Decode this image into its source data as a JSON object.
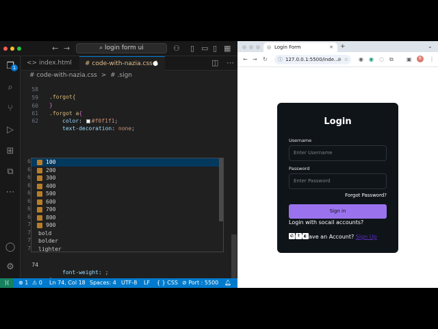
{
  "vscode": {
    "search": "login form ui",
    "tabs": [
      {
        "label": "<> index.html"
      },
      {
        "label": "# code-with-nazia.css 1"
      }
    ],
    "breadcrumb": [
      "# code-with-nazia.css",
      ">",
      "# .sign"
    ],
    "activity_badge": "1",
    "lines": {
      "l58": {
        "num": "58",
        "text": ".forgot{"
      },
      "l59": {
        "num": "59",
        "text": "}"
      },
      "l60": {
        "num": "60",
        "selector": ".forgot a",
        "brace": "{"
      },
      "l61": {
        "num": "61",
        "prop": "color",
        "colon": ":",
        "val": "#f0f1f1",
        "semi": ";"
      },
      "l62": {
        "num": "62",
        "prop": "text-decoration",
        "colon": ":",
        "val": "none",
        "semi": ";"
      },
      "l74": {
        "num": "74",
        "prop": "font-weight",
        "colon": ":",
        "val": ";"
      },
      "l75": {
        "num": "",
        "brace": "}"
      }
    },
    "gutter_repeat": "6",
    "gutter_repeat7": "7",
    "suggestions": [
      "100",
      "200",
      "300",
      "400",
      "500",
      "600",
      "700",
      "800",
      "900",
      "bold",
      "bolder",
      "lighter"
    ],
    "status": {
      "errors": "⊗ 1",
      "warnings": "⚠ 0",
      "position": "Ln 74, Col 18",
      "spaces": "Spaces: 4",
      "encoding": "UTF-8",
      "eol": "LF",
      "language": "{ } CSS",
      "port": "⊘ Port : 5500"
    }
  },
  "browser": {
    "tab_title": "Login Form",
    "new_tab": "+",
    "url": "127.0.0.1:5500/inde...",
    "card": {
      "title": "Login",
      "username_label": "Username",
      "username_placeholder": "Enter Username",
      "password_label": "Password",
      "password_placeholder": "Enter Password",
      "forgot": "Forgot Password?",
      "signin": "Sign in",
      "social_text": "Login with socail accounts?",
      "no_account": "Don't have an Account?",
      "signup": "Sign Up"
    }
  },
  "colors": {
    "accent": "#0078d4",
    "statusbar": "#007acc",
    "button": "#9b72ee",
    "card": "#0f1419"
  }
}
